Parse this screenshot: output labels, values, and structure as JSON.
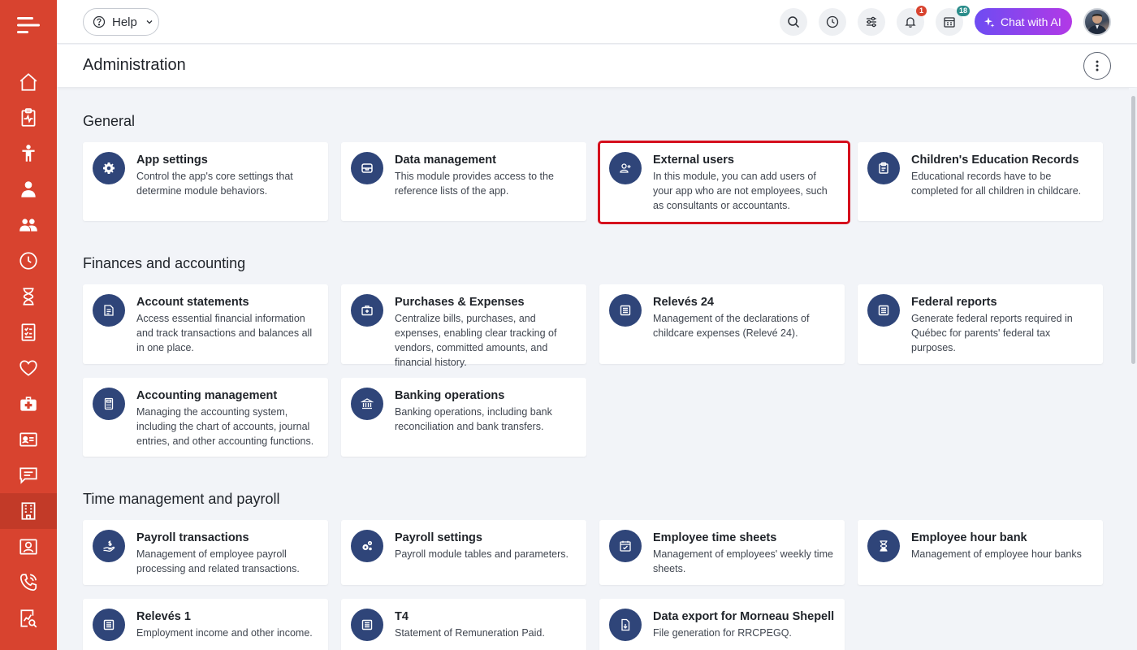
{
  "header": {
    "help_label": "Help",
    "chat_label": "Chat with AI",
    "notifications_count": "1",
    "calendar_count": "18"
  },
  "page": {
    "title": "Administration"
  },
  "sections": [
    {
      "title": "General",
      "cards": [
        {
          "title": "App settings",
          "desc": "Control the app's core settings that determine module behaviors.",
          "icon": "gear-icon"
        },
        {
          "title": "Data management",
          "desc": "This module provides access to the reference lists of the app.",
          "icon": "database-icon"
        },
        {
          "title": "External users",
          "desc": "In this module, you can add users of your app who are not employees, such as consultants or accountants.",
          "icon": "add-user-icon"
        },
        {
          "title": "Children's Education Records",
          "desc": "Educational records have to be completed for all children in childcare.",
          "icon": "clipboard-icon"
        }
      ]
    },
    {
      "title": "Finances and accounting",
      "cards": [
        {
          "title": "Account statements",
          "desc": "Access essential financial information and track transactions and balances all in one place.",
          "icon": "statement-icon"
        },
        {
          "title": "Purchases & Expenses",
          "desc": "Centralize bills, purchases, and expenses, enabling clear tracking of vendors, committed amounts, and financial history.",
          "icon": "briefcase-icon"
        },
        {
          "title": "Relevés 24",
          "desc": "Management of the declarations of childcare expenses (Relevé 24).",
          "icon": "document-icon"
        },
        {
          "title": "Federal reports",
          "desc": "Generate federal reports required in Québec for parents' federal tax purposes.",
          "icon": "document-icon"
        },
        {
          "title": "Accounting management",
          "desc": "Managing the accounting system, including the chart of accounts, journal entries, and other accounting functions.",
          "icon": "calculator-icon"
        },
        {
          "title": "Banking operations",
          "desc": "Banking operations, including bank reconciliation and bank transfers.",
          "icon": "bank-icon"
        }
      ]
    },
    {
      "title": "Time management and payroll",
      "cards": [
        {
          "title": "Payroll transactions",
          "desc": "Management of employee payroll processing and related transactions.",
          "icon": "payroll-icon"
        },
        {
          "title": "Payroll settings",
          "desc": "Payroll module tables and parameters.",
          "icon": "cogs-icon"
        },
        {
          "title": "Employee time sheets",
          "desc": "Management of employees' weekly time sheets.",
          "icon": "timesheet-icon"
        },
        {
          "title": "Employee hour bank",
          "desc": "Management of employee hour banks",
          "icon": "hourglass-icon"
        },
        {
          "title": "Relevés 1",
          "desc": "Employment income and other income.",
          "icon": "document-icon"
        },
        {
          "title": "T4",
          "desc": "Statement of Remuneration Paid.",
          "icon": "document-icon"
        },
        {
          "title": "Data export for Morneau Shepell",
          "desc": "File generation for RRCPEGQ.",
          "icon": "file-export-icon"
        }
      ]
    }
  ],
  "colors": {
    "sidebar": "#d8432f",
    "icon_circle": "#2f4579",
    "highlight": "#d50f1d"
  }
}
